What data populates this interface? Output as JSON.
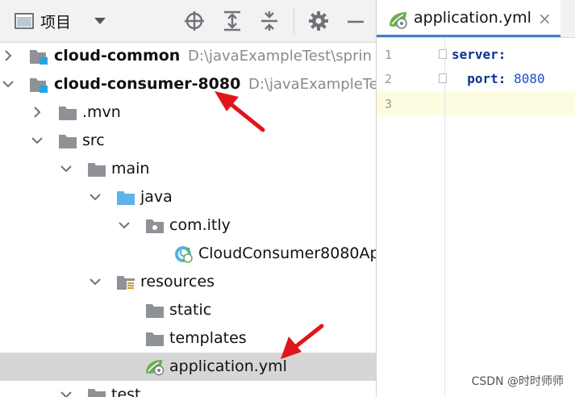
{
  "toolbar": {
    "view_label": "项目",
    "icons": [
      "project-view-icon",
      "dropdown-caret-icon",
      "locate-icon",
      "expand-all-icon",
      "collapse-all-icon",
      "gear-icon",
      "minimize-icon"
    ]
  },
  "tree": [
    {
      "label": "cloud-common",
      "path": "D:\\javaExampleTest\\sprin",
      "kind": "module",
      "expanded": false
    },
    {
      "label": "cloud-consumer-8080",
      "path": "D:\\javaExampleTe",
      "kind": "module",
      "expanded": true
    },
    {
      "label": ".mvn",
      "kind": "folder",
      "expanded": false
    },
    {
      "label": "src",
      "kind": "folder",
      "expanded": true
    },
    {
      "label": "main",
      "kind": "folder",
      "expanded": true
    },
    {
      "label": "java",
      "kind": "source-folder",
      "expanded": true
    },
    {
      "label": "com.itly",
      "kind": "package",
      "expanded": true
    },
    {
      "label": "CloudConsumer8080Ap",
      "kind": "spring-class"
    },
    {
      "label": "resources",
      "kind": "resources-folder",
      "expanded": true
    },
    {
      "label": "static",
      "kind": "folder"
    },
    {
      "label": "templates",
      "kind": "folder"
    },
    {
      "label": "application.yml",
      "kind": "yaml-file",
      "selected": true
    },
    {
      "label": "test",
      "kind": "folder",
      "expanded": true
    }
  ],
  "editor": {
    "tab_label": "application.yml",
    "close_glyph": "×",
    "line_numbers": [
      "1",
      "2",
      "3"
    ],
    "lines": [
      {
        "key": "server:",
        "value": ""
      },
      {
        "key": "port:",
        "value": "8080"
      },
      {
        "key": "",
        "value": ""
      }
    ]
  },
  "watermark": "CSDN @时时师师",
  "colors": {
    "accent": "#4083c9",
    "arrow": "#e0161c",
    "folder": "#8e9296",
    "java_folder": "#5eb4e8",
    "yaml": "#6bb14f"
  }
}
